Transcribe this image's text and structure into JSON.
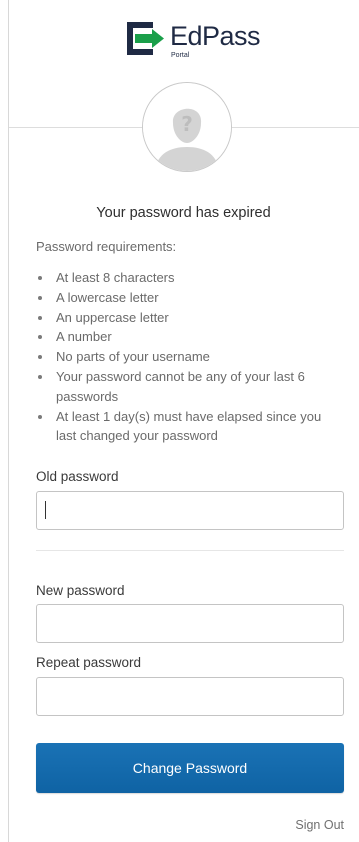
{
  "brand": {
    "name": "EdPass",
    "sub": "Portal",
    "colors": {
      "green": "#1a9f4a",
      "dark": "#1f2a44",
      "blue": "#1e68b0"
    }
  },
  "avatar": {
    "icon": "unknown-user-icon",
    "glyph": "?"
  },
  "title": "Your password has expired",
  "requirements": {
    "label": "Password requirements:",
    "items": [
      "At least 8 characters",
      "A lowercase letter",
      "An uppercase letter",
      "A number",
      "No parts of your username",
      "Your password cannot be any of your last 6 passwords",
      "At least 1 day(s) must have elapsed since you last changed your password"
    ]
  },
  "form": {
    "old_password": {
      "label": "Old password",
      "value": ""
    },
    "new_password": {
      "label": "New password",
      "value": ""
    },
    "repeat_password": {
      "label": "Repeat password",
      "value": ""
    },
    "submit_label": "Change Password"
  },
  "footer": {
    "sign_out": "Sign Out"
  },
  "colors": {
    "button": "#1a6dae",
    "text": "#5e5e5e",
    "border": "#c4c4c4"
  }
}
